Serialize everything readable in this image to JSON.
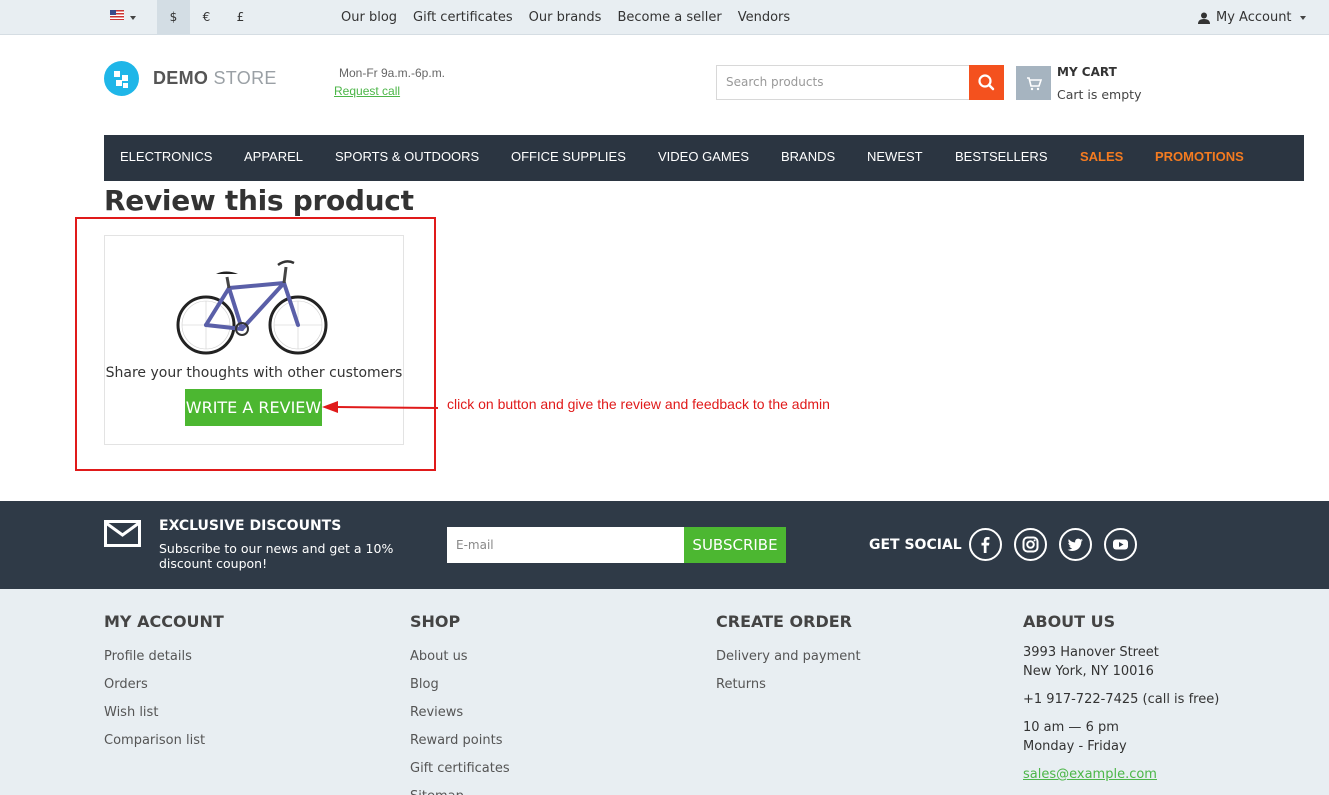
{
  "topbar": {
    "currencies": [
      "$",
      "€",
      "£"
    ],
    "links": [
      "Our blog",
      "Gift certificates",
      "Our brands",
      "Become a seller",
      "Vendors"
    ],
    "account": "My Account"
  },
  "header": {
    "logo_bold": "DEMO",
    "logo_light": " STORE",
    "hours": "Mon-Fr 9a.m.-6p.m.",
    "request_call": "Request call",
    "search_placeholder": "Search products",
    "cart_title": "MY CART",
    "cart_status": "Cart is empty"
  },
  "menu": [
    "ELECTRONICS",
    "APPAREL",
    "SPORTS & OUTDOORS",
    "OFFICE SUPPLIES",
    "VIDEO GAMES",
    "BRANDS",
    "NEWEST",
    "BESTSELLERS",
    "SALES",
    "PROMOTIONS"
  ],
  "main": {
    "title": "Review this product",
    "share_text": "Share your thoughts with other customers",
    "write_review": "WRITE A REVIEW",
    "annotation": "click on button and give the review and feedback to the admin",
    "annotation_color": "#e01a1a"
  },
  "subscribe": {
    "title": "EXCLUSIVE DISCOUNTS",
    "subtitle": "Subscribe to our news and get a 10% discount coupon!",
    "email_placeholder": "E-mail",
    "button": "SUBSCRIBE",
    "social_label": "GET SOCIAL",
    "social_icons": [
      "facebook-icon",
      "instagram-icon",
      "twitter-icon",
      "youtube-icon"
    ]
  },
  "footer": {
    "my_account": {
      "title": "MY ACCOUNT",
      "links": [
        "Profile details",
        "Orders",
        "Wish list",
        "Comparison list"
      ]
    },
    "shop": {
      "title": "SHOP",
      "links": [
        "About us",
        "Blog",
        "Reviews",
        "Reward points",
        "Gift certificates",
        "Sitemap"
      ]
    },
    "create_order": {
      "title": "CREATE ORDER",
      "links": [
        "Delivery and payment",
        "Returns"
      ]
    },
    "about": {
      "title": "ABOUT US",
      "address1": "3993 Hanover Street",
      "address2": "New York, NY 10016",
      "phone": "+1 917-722-7425 (call is free)",
      "hours1": "10 am — 6 pm",
      "hours2": "Monday - Friday",
      "email": "sales@example.com"
    }
  },
  "colors": {
    "accent_green": "#4cb731",
    "accent_orange": "#f4511e",
    "menu_bg": "#2b3541",
    "band_bg": "#2f3a47"
  }
}
